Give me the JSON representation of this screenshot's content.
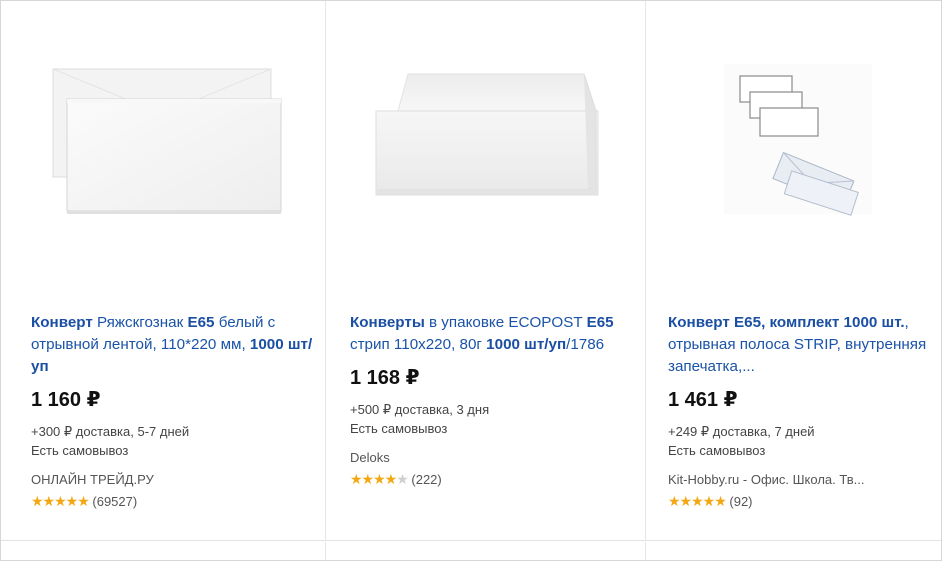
{
  "products": [
    {
      "title_parts": [
        {
          "text": "Конверт",
          "bold": true
        },
        {
          "text": " Ряжскгознак ",
          "bold": false
        },
        {
          "text": "Е65",
          "bold": true
        },
        {
          "text": " белый с отрывной лентой, 110*220 мм, ",
          "bold": false
        },
        {
          "text": "1000 шт/уп",
          "bold": true
        }
      ],
      "price": "1 160 ₽",
      "delivery": "+300 ₽ доставка, 5-7 дней",
      "pickup": "Есть самовывоз",
      "shop": "ОНЛАЙН ТРЕЙД.РУ",
      "stars_full": "★★★★★",
      "stars_empty": "",
      "reviews": "(69527)",
      "rating_value": 5,
      "image_icon": "envelope-pair-image"
    },
    {
      "title_parts": [
        {
          "text": "Конверты",
          "bold": true
        },
        {
          "text": " в упаковке ECOPOST ",
          "bold": false
        },
        {
          "text": "E65",
          "bold": true
        },
        {
          "text": " стрип 110х220, 80г ",
          "bold": false
        },
        {
          "text": "1000 шт/уп",
          "bold": true
        },
        {
          "text": "/1786",
          "bold": false
        }
      ],
      "price": "1 168 ₽",
      "delivery": "+500 ₽ доставка, 3 дня",
      "pickup": "Есть самовывоз",
      "shop": "Deloks",
      "stars_full": "★★★★",
      "stars_empty": "★",
      "reviews": "(222)",
      "rating_value": 4,
      "image_icon": "envelope-pack-image"
    },
    {
      "title_parts": [
        {
          "text": "Конверт Е65",
          "bold": true
        },
        {
          "text": ", ",
          "bold": false
        },
        {
          "text": "комплект 1000 шт.",
          "bold": true
        },
        {
          "text": ", отрывная полоса STRIP, внутренняя запечатка,...",
          "bold": false
        }
      ],
      "price": "1 461 ₽",
      "delivery": "+249 ₽ доставка, 7 дней",
      "pickup": "Есть самовывоз",
      "shop": "Kit-Hobby.ru - Офис. Школа. Тв...",
      "stars_full": "★★★★★",
      "stars_empty": "",
      "reviews": "(92)",
      "rating_value": 5,
      "image_icon": "envelope-set-image"
    }
  ],
  "colors": {
    "link": "#1a53a8",
    "price": "#111111",
    "star": "#f3a712",
    "star_off": "#cfcfcf",
    "muted": "#444444"
  }
}
